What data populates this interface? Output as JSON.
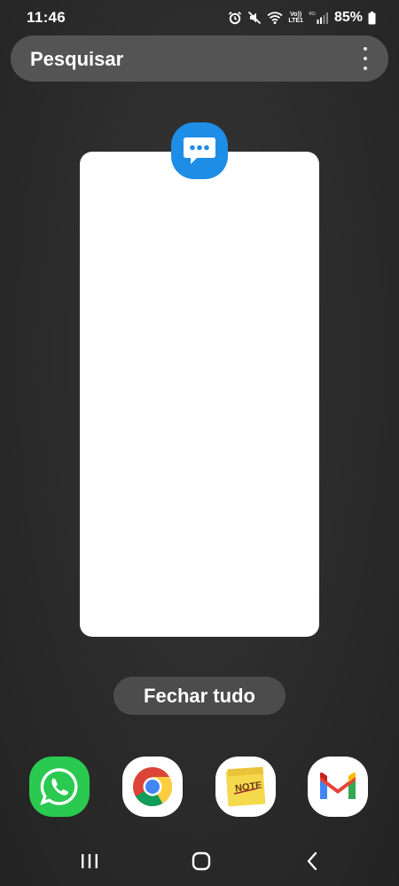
{
  "status_bar": {
    "time": "11:46",
    "network_vol": "Vo))",
    "network_lte": "LTE1",
    "network_4g": "4G",
    "battery": "85%",
    "icons": [
      "alarm-icon",
      "mute-icon",
      "wifi-icon",
      "volte-icon",
      "signal-icon",
      "battery-icon"
    ]
  },
  "search": {
    "label": "Pesquisar",
    "menu_icon": "more-vert-icon"
  },
  "recent_app": {
    "icon": "messages-icon",
    "icon_color": "#1e8de6"
  },
  "close_all_label": "Fechar tudo",
  "dock": {
    "apps": [
      {
        "name": "WhatsApp",
        "icon": "whatsapp-icon",
        "color": "#25d366"
      },
      {
        "name": "Chrome",
        "icon": "chrome-icon",
        "color": "#ffffff"
      },
      {
        "name": "Notes",
        "icon": "note-icon",
        "label": "NOTE",
        "color": "#f7e27a"
      },
      {
        "name": "Gmail",
        "icon": "gmail-icon",
        "color": "#ffffff"
      }
    ]
  },
  "nav_bar": {
    "icons": [
      "recents-icon",
      "home-icon",
      "back-icon"
    ]
  }
}
